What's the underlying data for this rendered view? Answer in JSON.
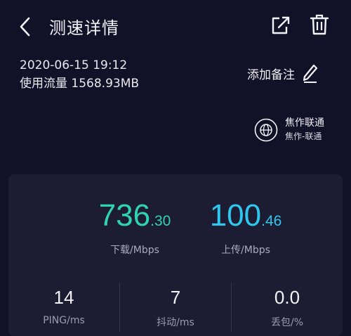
{
  "header": {
    "title": "测速详情"
  },
  "meta": {
    "datetime": "2020-06-15 19:12",
    "traffic": "使用流量 1568.93MB"
  },
  "note": {
    "label": "添加备注"
  },
  "isp": {
    "name": "焦作联通",
    "sub": "焦作-联通"
  },
  "download": {
    "int": "736",
    "dec": ".30",
    "label": "下载/Mbps"
  },
  "upload": {
    "int": "100",
    "dec": ".46",
    "label": "上传/Mbps"
  },
  "stats": [
    {
      "value": "14",
      "label": "PING/ms"
    },
    {
      "value": "7",
      "label": "抖动/ms"
    },
    {
      "value": "0.0",
      "label": "丢包/%"
    }
  ],
  "colors": {
    "background": "#111228",
    "card": "#1c1d33",
    "download": "#2fd3b4",
    "upload": "#2ec8ef"
  },
  "icons": [
    "back-arrow-icon",
    "share-icon",
    "trash-icon",
    "pencil-icon",
    "globe-icon"
  ]
}
